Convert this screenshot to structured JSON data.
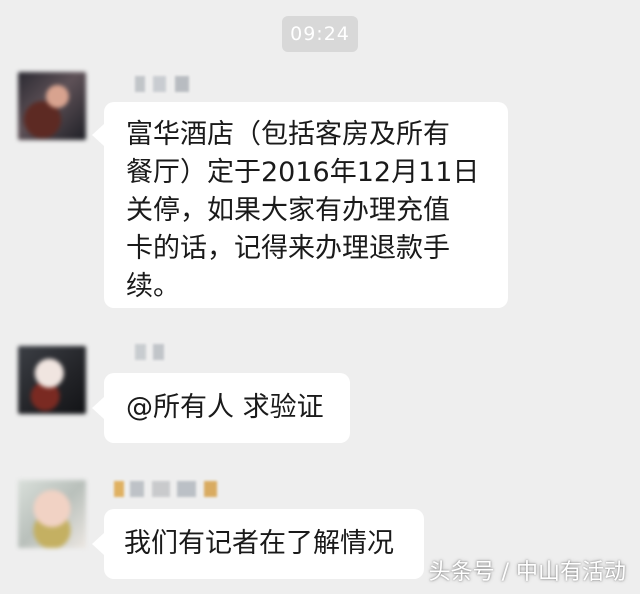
{
  "chat": {
    "timestamp": "09:24",
    "messages": [
      {
        "avatar": "avatar-blurred",
        "name_placeholder": "blurred-name",
        "text": "富华酒店（包括客房及所有\n餐厅）定于2016年12月11日\n关停，如果大家有办理充值\n卡的话，记得来办理退款手\n续。"
      },
      {
        "avatar": "avatar-blurred",
        "name_placeholder": "blurred-name",
        "text": "@所有人  求验证"
      },
      {
        "avatar": "avatar-blurred",
        "name_placeholder": "blurred-name",
        "text": "我们有记者在了解情况"
      }
    ]
  },
  "overlay": {
    "watermark": "头条号 / 中山有活动"
  },
  "colors": {
    "background": "#eeeeee",
    "timestamp_bg": "#d8d8d8",
    "bubble_bg": "#ffffff",
    "text": "#1a1a1a"
  }
}
